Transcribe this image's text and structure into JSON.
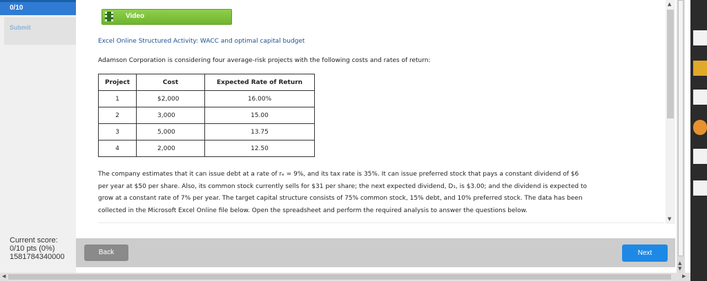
{
  "sidebar": {
    "question_label": "0/10",
    "submit_label": "Submit",
    "score_heading": "Current score:",
    "score_value": "0/10 pts (0%)",
    "score_id": "1581784340000"
  },
  "video": {
    "label": "Video",
    "icon": "film-icon"
  },
  "activity_title": "Excel Online Structured Activity: WACC and optimal capital budget",
  "intro": "Adamson Corporation is considering four average-risk projects with the following costs and rates of return:",
  "table": {
    "headers": [
      "Project",
      "Cost",
      "Expected Rate of Return"
    ],
    "rows": [
      [
        "1",
        "$2,000",
        "16.00%"
      ],
      [
        "2",
        "3,000",
        "15.00"
      ],
      [
        "3",
        "5,000",
        "13.75"
      ],
      [
        "4",
        "2,000",
        "12.50"
      ]
    ]
  },
  "paragraph_lines": [
    "The company estimates that it can issue debt at a rate of rₑ = 9%, and its tax rate is 35%. It can issue preferred stock that pays a constant dividend of $6",
    "per year at $50 per share. Also, its common stock currently sells for $31 per share; the next expected dividend, D₁, is $3.00; and the dividend is expected to",
    "grow at a constant rate of 7% per year. The target capital structure consists of 75% common stock, 15% debt, and 10% preferred stock. The data has been",
    "collected in the Microsoft Excel Online file below. Open the spreadsheet and perform the required analysis to answer the questions below."
  ],
  "buttons": {
    "back": "Back",
    "next": "Next"
  },
  "colors": {
    "accent": "#1e88e5",
    "video_green": "#7dc23a",
    "title_blue": "#1d4f91"
  }
}
